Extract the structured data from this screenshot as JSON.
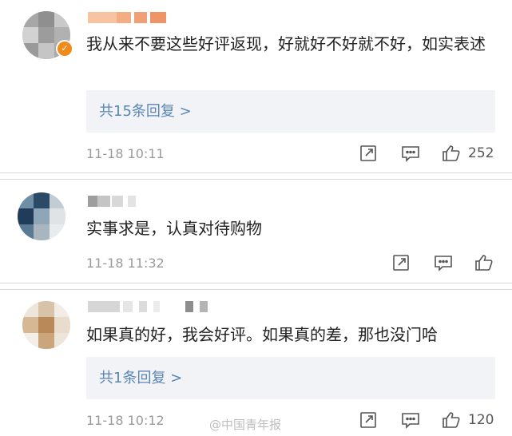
{
  "comments": [
    {
      "text": "我从来不要这些好评返现，好就好不好就不好，如实表述",
      "replies_label": "共15条回复 >",
      "time": "11-18 10:11",
      "likes": "252"
    },
    {
      "text": "实事求是，认真对待购物",
      "time": "11-18 11:32"
    },
    {
      "text": "如果真的好，我会好评。如果真的差，那也没门哈",
      "replies_label": "共1条回复 >",
      "time": "11-18 10:12",
      "likes": "120"
    }
  ],
  "watermark": "@中国青年报",
  "icons": [
    "share-icon",
    "comment-icon",
    "like-icon",
    "verified-badge-icon"
  ],
  "colors": {
    "reply_link": "#5a86b5",
    "badge": "#f28a1a",
    "reply_bg": "#f1f3f6"
  }
}
